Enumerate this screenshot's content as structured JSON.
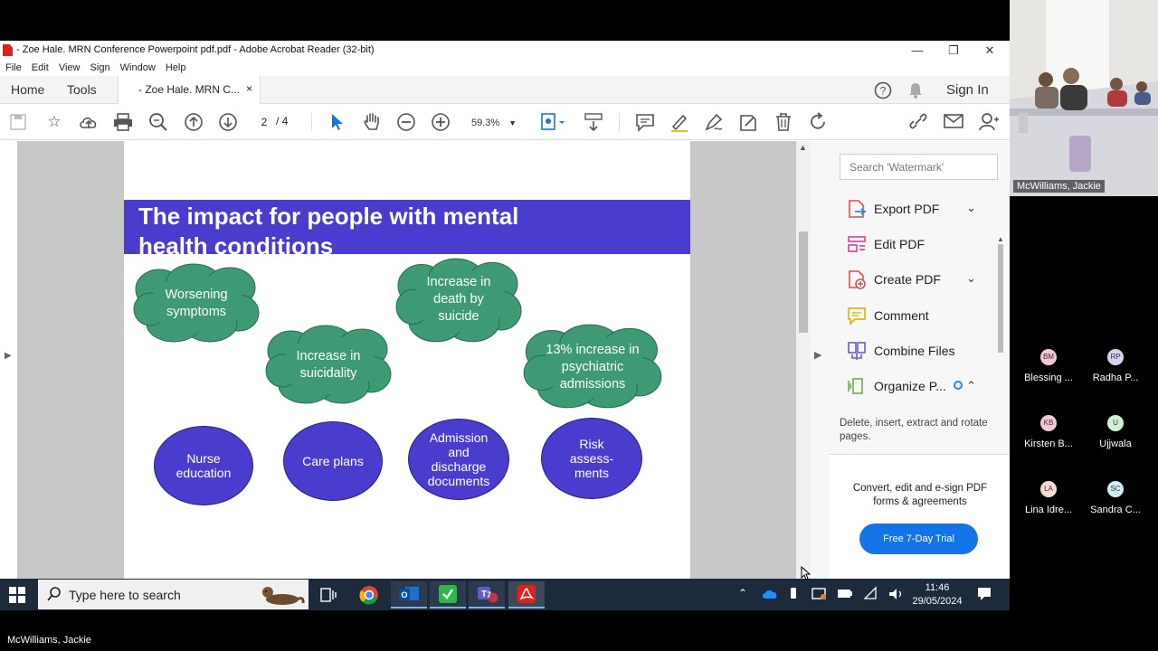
{
  "window": {
    "title": "- Zoe Hale. MRN Conference Powerpoint pdf.pdf - Adobe Acrobat Reader (32-bit)",
    "controls": {
      "minimize": "—",
      "restore": "❐",
      "close": "✕"
    }
  },
  "menu": [
    "File",
    "Edit",
    "View",
    "Sign",
    "Window",
    "Help"
  ],
  "tabs": {
    "home": "Home",
    "tools": "Tools",
    "document": "- Zoe Hale. MRN C...",
    "close": "×",
    "sign_in": "Sign In"
  },
  "toolbar": {
    "page_current": "2",
    "page_total": "/ 4",
    "zoom": "59.3%"
  },
  "slide": {
    "title_line1": "The impact for people with mental",
    "title_line2": "health conditions",
    "clouds": [
      {
        "text": "Worsening symptoms"
      },
      {
        "text": "Increase in suicidality"
      },
      {
        "text": "Increase in death by suicide"
      },
      {
        "text": "13% increase in psychiatric admissions"
      }
    ],
    "ovals": [
      {
        "text": "Nurse education"
      },
      {
        "text": "Care plans"
      },
      {
        "text": "Admission and discharge documents"
      },
      {
        "text": "Risk assess-ments"
      }
    ],
    "colors": {
      "banner": "#4a3ccc",
      "cloud": "#3d9a74",
      "oval": "#4a3ccc"
    }
  },
  "right_pane": {
    "search_placeholder": "Search 'Watermark'",
    "tools": [
      {
        "label": "Export PDF",
        "icon": "export-pdf-icon"
      },
      {
        "label": "Edit PDF",
        "icon": "edit-pdf-icon"
      },
      {
        "label": "Create PDF",
        "icon": "create-pdf-icon"
      },
      {
        "label": "Comment",
        "icon": "comment-icon"
      },
      {
        "label": "Combine Files",
        "icon": "combine-files-icon"
      },
      {
        "label": "Organize P...",
        "icon": "organize-pages-icon"
      }
    ],
    "organize_desc": "Delete, insert, extract and rotate pages.",
    "promo_text": "Convert, edit and e-sign PDF forms & agreements",
    "trial_button": "Free 7-Day Trial"
  },
  "taskbar": {
    "search_placeholder": "Type here to search",
    "time": "11:46",
    "date": "29/05/2024",
    "teams_badge": "7"
  },
  "meeting": {
    "video_name": "McWilliams, Jackie",
    "participants": [
      {
        "initials": "BM",
        "name": "Blessing ...",
        "color": "#f4c9d4"
      },
      {
        "initials": "RP",
        "name": "Radha P...",
        "color": "#d6d2f4"
      },
      {
        "initials": "KB",
        "name": "Kirsten B...",
        "color": "#f4c9d4"
      },
      {
        "initials": "U",
        "name": "Ujjwala",
        "color": "#d3f0d6"
      },
      {
        "initials": "LA",
        "name": "Lina Idre...",
        "color": "#f4ddd2"
      },
      {
        "initials": "SC",
        "name": "Sandra C...",
        "color": "#d2eef4"
      }
    ],
    "bottom_name": "McWilliams, Jackie"
  }
}
